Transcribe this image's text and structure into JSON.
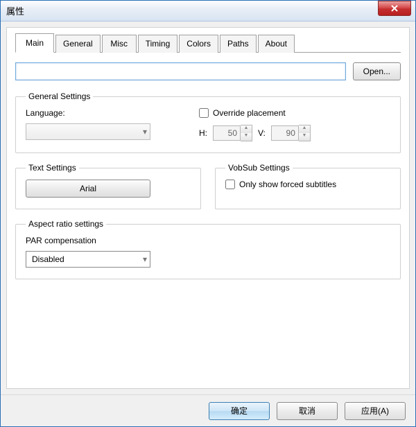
{
  "window": {
    "title": "属性"
  },
  "tabs": [
    "Main",
    "General",
    "Misc",
    "Timing",
    "Colors",
    "Paths",
    "About"
  ],
  "active_tab_index": 0,
  "open_button": "Open...",
  "path_value": "",
  "general_settings": {
    "legend": "General Settings",
    "language_label": "Language:",
    "language_value": "",
    "override_label": "Override placement",
    "override_checked": false,
    "h_label": "H:",
    "h_value": "50",
    "v_label": "V:",
    "v_value": "90"
  },
  "text_settings": {
    "legend": "Text Settings",
    "font_button": "Arial"
  },
  "vobsub_settings": {
    "legend": "VobSub Settings",
    "forced_label": "Only show forced subtitles",
    "forced_checked": false
  },
  "aspect": {
    "legend": "Aspect ratio settings",
    "par_label": "PAR compensation",
    "par_value": "Disabled"
  },
  "footer": {
    "ok": "确定",
    "cancel": "取消",
    "apply": "应用(A)"
  }
}
